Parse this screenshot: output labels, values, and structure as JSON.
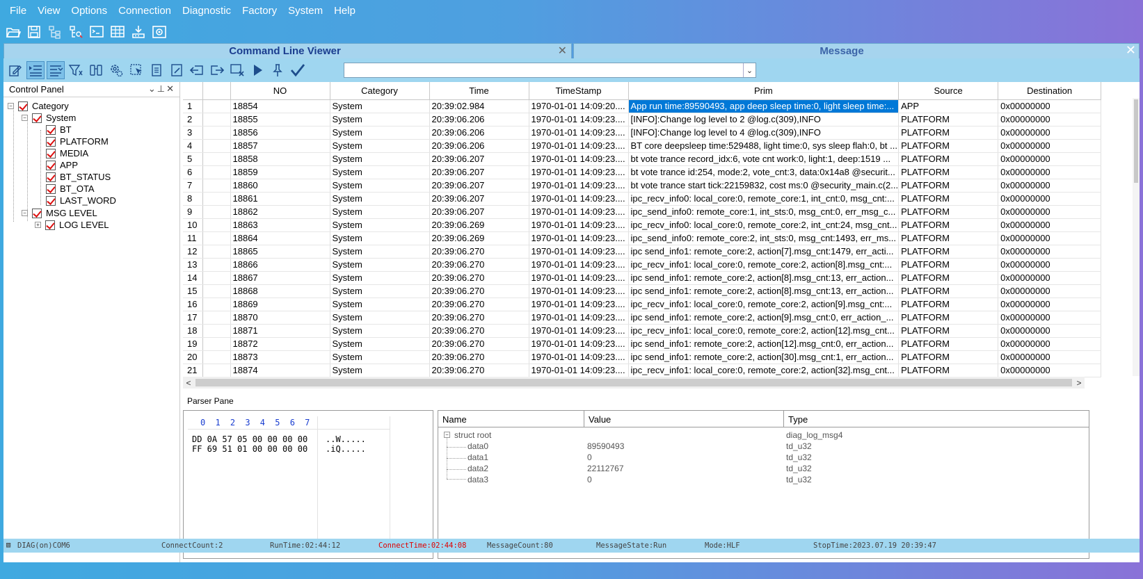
{
  "menu": [
    "File",
    "View",
    "Options",
    "Connection",
    "Diagnostic",
    "Factory",
    "System",
    "Help"
  ],
  "tabs": {
    "left_title": "Command Line Viewer",
    "right_title": "Message"
  },
  "filter": {
    "value": ""
  },
  "control_panel": {
    "title": "Control Panel",
    "tree": {
      "category": "Category",
      "system": "System",
      "items": [
        "BT",
        "PLATFORM",
        "MEDIA",
        "APP",
        "BT_STATUS",
        "BT_OTA",
        "LAST_WORD"
      ],
      "msg_level": "MSG LEVEL",
      "log_level": "LOG LEVEL"
    }
  },
  "grid": {
    "columns": [
      "NO",
      "Category",
      "Time",
      "TimeStamp",
      "Prim",
      "Source",
      "Destination"
    ],
    "rows": [
      [
        "1",
        "18854",
        "System",
        "20:39:02.984",
        "1970-01-01 14:09:20....",
        "App run time:89590493, app deep sleep time:0, light sleep time:...",
        "APP",
        "0x00000000"
      ],
      [
        "2",
        "18855",
        "System",
        "20:39:06.206",
        "1970-01-01 14:09:23....",
        "[INFO]:Change log level to 2 @log.c(309),INFO",
        "PLATFORM",
        "0x00000000"
      ],
      [
        "3",
        "18856",
        "System",
        "20:39:06.206",
        "1970-01-01 14:09:23....",
        "[INFO]:Change log level to 4 @log.c(309),INFO",
        "PLATFORM",
        "0x00000000"
      ],
      [
        "4",
        "18857",
        "System",
        "20:39:06.206",
        "1970-01-01 14:09:23....",
        "BT core deepsleep time:529488, light time:0, sys sleep flah:0, bt ...",
        "PLATFORM",
        "0x00000000"
      ],
      [
        "5",
        "18858",
        "System",
        "20:39:06.207",
        "1970-01-01 14:09:23....",
        "bt vote trance record_idx:6, vote cnt work:0, light:1, deep:1519 ...",
        "PLATFORM",
        "0x00000000"
      ],
      [
        "6",
        "18859",
        "System",
        "20:39:06.207",
        "1970-01-01 14:09:23....",
        "bt vote trance id:254, mode:2, vote_cnt:3, data:0x14a8 @securit...",
        "PLATFORM",
        "0x00000000"
      ],
      [
        "7",
        "18860",
        "System",
        "20:39:06.207",
        "1970-01-01 14:09:23....",
        "bt vote trance start tick:22159832, cost ms:0 @security_main.c(2...",
        "PLATFORM",
        "0x00000000"
      ],
      [
        "8",
        "18861",
        "System",
        "20:39:06.207",
        "1970-01-01 14:09:23....",
        "ipc_recv_info0: local_core:0, remote_core:1, int_cnt:0, msg_cnt:...",
        "PLATFORM",
        "0x00000000"
      ],
      [
        "9",
        "18862",
        "System",
        "20:39:06.207",
        "1970-01-01 14:09:23....",
        "ipc_send_info0: remote_core:1, int_sts:0, msg_cnt:0, err_msg_c...",
        "PLATFORM",
        "0x00000000"
      ],
      [
        "10",
        "18863",
        "System",
        "20:39:06.269",
        "1970-01-01 14:09:23....",
        "ipc_recv_info0: local_core:0, remote_core:2, int_cnt:24, msg_cnt...",
        "PLATFORM",
        "0x00000000"
      ],
      [
        "11",
        "18864",
        "System",
        "20:39:06.269",
        "1970-01-01 14:09:23....",
        "ipc_send_info0: remote_core:2, int_sts:0, msg_cnt:1493, err_ms...",
        "PLATFORM",
        "0x00000000"
      ],
      [
        "12",
        "18865",
        "System",
        "20:39:06.270",
        "1970-01-01 14:09:23....",
        "ipc send_info1: remote_core:2, action[7].msg_cnt:1479, err_acti...",
        "PLATFORM",
        "0x00000000"
      ],
      [
        "13",
        "18866",
        "System",
        "20:39:06.270",
        "1970-01-01 14:09:23....",
        "ipc_recv_info1: local_core:0, remote_core:2, action[8].msg_cnt:...",
        "PLATFORM",
        "0x00000000"
      ],
      [
        "14",
        "18867",
        "System",
        "20:39:06.270",
        "1970-01-01 14:09:23....",
        "ipc send_info1: remote_core:2, action[8].msg_cnt:13, err_action...",
        "PLATFORM",
        "0x00000000"
      ],
      [
        "15",
        "18868",
        "System",
        "20:39:06.270",
        "1970-01-01 14:09:23....",
        "ipc send_info1: remote_core:2, action[8].msg_cnt:13, err_action...",
        "PLATFORM",
        "0x00000000"
      ],
      [
        "16",
        "18869",
        "System",
        "20:39:06.270",
        "1970-01-01 14:09:23....",
        "ipc_recv_info1: local_core:0, remote_core:2, action[9].msg_cnt:...",
        "PLATFORM",
        "0x00000000"
      ],
      [
        "17",
        "18870",
        "System",
        "20:39:06.270",
        "1970-01-01 14:09:23....",
        "ipc send_info1: remote_core:2, action[9].msg_cnt:0, err_action_...",
        "PLATFORM",
        "0x00000000"
      ],
      [
        "18",
        "18871",
        "System",
        "20:39:06.270",
        "1970-01-01 14:09:23....",
        "ipc_recv_info1: local_core:0, remote_core:2, action[12].msg_cnt...",
        "PLATFORM",
        "0x00000000"
      ],
      [
        "19",
        "18872",
        "System",
        "20:39:06.270",
        "1970-01-01 14:09:23....",
        "ipc send_info1: remote_core:2, action[12].msg_cnt:0, err_action...",
        "PLATFORM",
        "0x00000000"
      ],
      [
        "20",
        "18873",
        "System",
        "20:39:06.270",
        "1970-01-01 14:09:23....",
        "ipc send_info1: remote_core:2, action[30].msg_cnt:1, err_action...",
        "PLATFORM",
        "0x00000000"
      ],
      [
        "21",
        "18874",
        "System",
        "20:39:06.270",
        "1970-01-01 14:09:23....",
        "ipc_recv_info1: local_core:0, remote_core:2, action[32].msg_cnt...",
        "PLATFORM",
        "0x00000000"
      ]
    ]
  },
  "parser": {
    "title": "Parser Pane",
    "hex_header": "0 1 2 3 4 5 6 7",
    "hex_rows": [
      "DD 0A 57 05 00 00 00 00",
      "FF 69 51 01 00 00 00 00"
    ],
    "ascii_rows": [
      "..W.....",
      ".iQ....."
    ],
    "columns": {
      "name": "Name",
      "value": "Value",
      "type": "Type"
    },
    "root": {
      "name": "struct root",
      "type": "diag_log_msg4"
    },
    "fields": [
      {
        "name": "data0",
        "value": "89590493",
        "type": "td_u32"
      },
      {
        "name": "data1",
        "value": "0",
        "type": "td_u32"
      },
      {
        "name": "data2",
        "value": "22112767",
        "type": "td_u32"
      },
      {
        "name": "data3",
        "value": "0",
        "type": "td_u32"
      }
    ]
  },
  "status": {
    "port": "DIAG(on)COM6",
    "connect_count": "ConnectCount:2",
    "run_time": "RunTime:02:44:12",
    "connect_time": "ConnectTime:02:44:08",
    "message_count": "MessageCount:80",
    "message_state": "MessageState:Run",
    "mode": "Mode:HLF",
    "stop_time": "StopTime:2023.07.19 20:39:47"
  },
  "colors": {
    "selection": "#0078d7",
    "connect_time": "#e00000",
    "toolbar": "#9fd6f0"
  }
}
